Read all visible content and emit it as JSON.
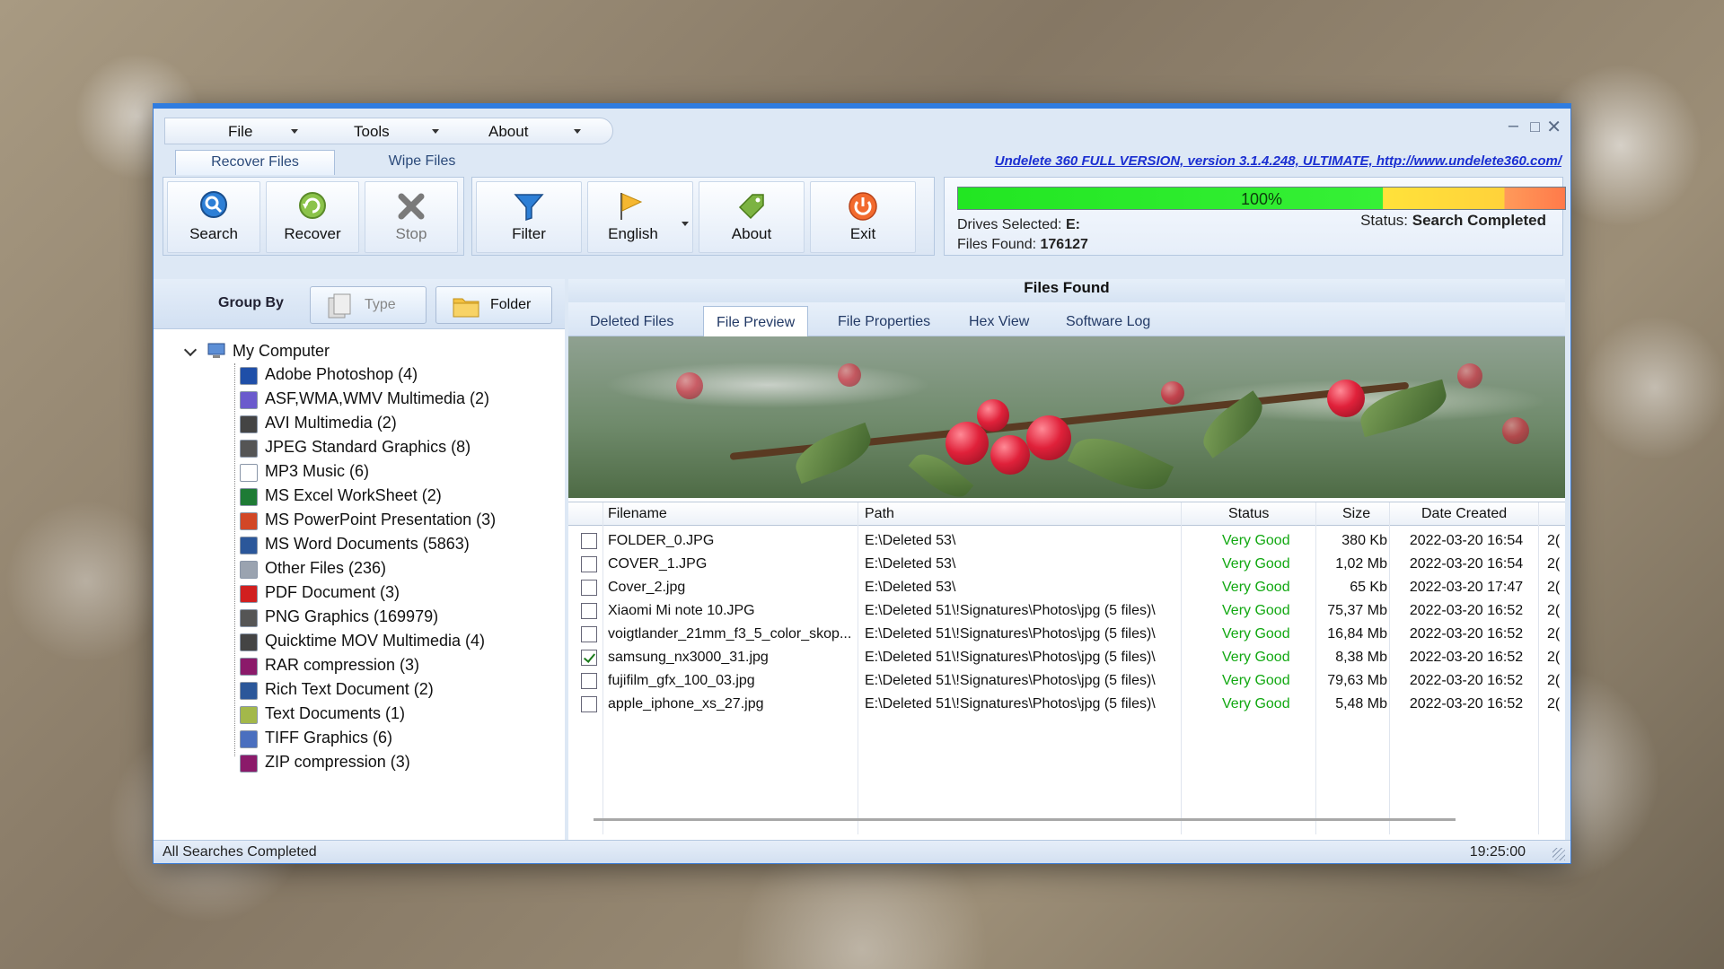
{
  "menu": {
    "items": [
      {
        "label": "File",
        "underline": "F"
      },
      {
        "label": "Tools",
        "underline": "T"
      },
      {
        "label": "About",
        "underline": "A"
      }
    ]
  },
  "main_tabs": [
    {
      "label": "Recover Files",
      "active": true
    },
    {
      "label": "Wipe Files",
      "active": false
    }
  ],
  "version_link": "Undelete 360 FULL VERSION, version 3.1.4.248, ULTIMATE, http://www.undelete360.com/",
  "toolbar": {
    "search": "Search",
    "recover": "Recover",
    "stop": "Stop",
    "filter": "Filter",
    "english": "English",
    "about": "About",
    "exit": "Exit"
  },
  "status_panel": {
    "progress_text": "100%",
    "progress_value": 100,
    "drives_label": "Drives Selected:",
    "drives_value": "E:",
    "found_label": "Files Found:",
    "found_value": "176127",
    "status_label": "Status:",
    "status_value": "Search Completed"
  },
  "group_by": {
    "label": "Group By",
    "type_btn": "Type",
    "folder_btn": "Folder"
  },
  "tree": {
    "root": "My Computer",
    "items": [
      {
        "label": "Adobe Photoshop (4)",
        "icon": "photoshop-icon",
        "color": "#1f4fa8"
      },
      {
        "label": "ASF,WMA,WMV Multimedia (2)",
        "icon": "media-icon",
        "color": "#6a5acd"
      },
      {
        "label": "AVI Multimedia (2)",
        "icon": "film-icon",
        "color": "#444444"
      },
      {
        "label": "JPEG Standard Graphics (8)",
        "icon": "image-icon",
        "color": "#555555"
      },
      {
        "label": "MP3 Music (6)",
        "icon": "music-file-icon",
        "color": "#ffffff"
      },
      {
        "label": "MS Excel WorkSheet (2)",
        "icon": "excel-icon",
        "color": "#1e7b35"
      },
      {
        "label": "MS PowerPoint Presentation (3)",
        "icon": "powerpoint-icon",
        "color": "#d24726"
      },
      {
        "label": "MS Word Documents (5863)",
        "icon": "word-icon",
        "color": "#2b579a"
      },
      {
        "label": "Other Files (236)",
        "icon": "file-icon",
        "color": "#9aa3b0"
      },
      {
        "label": "PDF Document (3)",
        "icon": "pdf-icon",
        "color": "#d11f1f"
      },
      {
        "label": "PNG Graphics (169979)",
        "icon": "image-icon",
        "color": "#555555"
      },
      {
        "label": "Quicktime MOV Multimedia (4)",
        "icon": "film-icon",
        "color": "#444444"
      },
      {
        "label": "RAR compression (3)",
        "icon": "rar-icon",
        "color": "#8b1a6a"
      },
      {
        "label": "Rich Text Document (2)",
        "icon": "word-icon",
        "color": "#2b579a"
      },
      {
        "label": "Text Documents (1)",
        "icon": "text-file-icon",
        "color": "#a3b84a"
      },
      {
        "label": "TIFF Graphics (6)",
        "icon": "tiff-icon",
        "color": "#4a6fbf"
      },
      {
        "label": "ZIP compression (3)",
        "icon": "zip-icon",
        "color": "#8b1a6a"
      }
    ]
  },
  "right": {
    "title": "Files Found",
    "tabs": [
      {
        "label": "Deleted Files",
        "active": false
      },
      {
        "label": "File Preview",
        "active": true
      },
      {
        "label": "File Properties",
        "active": false
      },
      {
        "label": "Hex View",
        "active": false
      },
      {
        "label": "Software Log",
        "active": false
      }
    ]
  },
  "table": {
    "headers": {
      "filename": "Filename",
      "path": "Path",
      "status": "Status",
      "size": "Size",
      "date": "Date Created"
    },
    "rows": [
      {
        "checked": false,
        "filename": "FOLDER_0.JPG",
        "path": "E:\\Deleted 53\\",
        "status": "Very Good",
        "size": "380 Kb",
        "date": "2022-03-20 16:54",
        "extra": "2("
      },
      {
        "checked": false,
        "filename": "COVER_1.JPG",
        "path": "E:\\Deleted 53\\",
        "status": "Very Good",
        "size": "1,02 Mb",
        "date": "2022-03-20 16:54",
        "extra": "2("
      },
      {
        "checked": false,
        "filename": "Cover_2.jpg",
        "path": "E:\\Deleted 53\\",
        "status": "Very Good",
        "size": "65 Kb",
        "date": "2022-03-20 17:47",
        "extra": "2("
      },
      {
        "checked": false,
        "filename": "Xiaomi Mi note 10.JPG",
        "path": "E:\\Deleted 51\\!Signatures\\Photos\\jpg (5 files)\\",
        "status": "Very Good",
        "size": "75,37 Mb",
        "date": "2022-03-20 16:52",
        "extra": "2("
      },
      {
        "checked": false,
        "filename": "voigtlander_21mm_f3_5_color_skop...",
        "path": "E:\\Deleted 51\\!Signatures\\Photos\\jpg (5 files)\\",
        "status": "Very Good",
        "size": "16,84 Mb",
        "date": "2022-03-20 16:52",
        "extra": "2("
      },
      {
        "checked": true,
        "filename": "samsung_nx3000_31.jpg",
        "path": "E:\\Deleted 51\\!Signatures\\Photos\\jpg (5 files)\\",
        "status": "Very Good",
        "size": "8,38 Mb",
        "date": "2022-03-20 16:52",
        "extra": "2("
      },
      {
        "checked": false,
        "filename": "fujifilm_gfx_100_03.jpg",
        "path": "E:\\Deleted 51\\!Signatures\\Photos\\jpg (5 files)\\",
        "status": "Very Good",
        "size": "79,63 Mb",
        "date": "2022-03-20 16:52",
        "extra": "2("
      },
      {
        "checked": false,
        "filename": "apple_iphone_xs_27.jpg",
        "path": "E:\\Deleted 51\\!Signatures\\Photos\\jpg (5 files)\\",
        "status": "Very Good",
        "size": "5,48 Mb",
        "date": "2022-03-20 16:52",
        "extra": "2("
      }
    ]
  },
  "statusbar": {
    "left": "All Searches Completed",
    "time": "19:25:00"
  },
  "colors": {
    "accent": "#2f7ce0",
    "status_good": "#11a811",
    "link": "#1b2fd1"
  }
}
